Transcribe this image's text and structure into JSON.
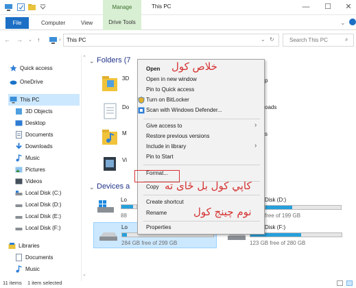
{
  "window": {
    "ribbon_context_label": "Manage",
    "title": "This PC",
    "minimize_label": "—",
    "maximize_label": "☐",
    "close_label": "✕",
    "accent_color": "#1c6fc4"
  },
  "ribbon": {
    "tabs": [
      "File",
      "Computer",
      "View",
      "Drive Tools"
    ]
  },
  "address": {
    "path_text": "This PC",
    "search_placeholder": "Search This PC"
  },
  "nav_pane": {
    "items": [
      {
        "label": "Quick access",
        "icon": "star-icon"
      },
      {
        "label": "OneDrive",
        "icon": "cloud-icon"
      },
      {
        "label": "This PC",
        "icon": "computer-icon",
        "selected": true
      },
      {
        "label": "3D Objects",
        "icon": "cube-icon"
      },
      {
        "label": "Desktop",
        "icon": "desktop-icon"
      },
      {
        "label": "Documents",
        "icon": "document-icon"
      },
      {
        "label": "Downloads",
        "icon": "download-icon"
      },
      {
        "label": "Music",
        "icon": "music-icon"
      },
      {
        "label": "Pictures",
        "icon": "pictures-icon"
      },
      {
        "label": "Videos",
        "icon": "videos-icon"
      },
      {
        "label": "Local Disk (C:)",
        "icon": "drive-icon"
      },
      {
        "label": "Local Disk (D:)",
        "icon": "drive-icon"
      },
      {
        "label": "Local Disk (E:)",
        "icon": "drive-icon"
      },
      {
        "label": "Local Disk (F:)",
        "icon": "drive-icon"
      },
      {
        "label": "Libraries",
        "icon": "libraries-icon"
      },
      {
        "label": "Documents",
        "icon": "document-icon"
      },
      {
        "label": "Music",
        "icon": "music-icon"
      }
    ]
  },
  "content": {
    "folders_group": "Folders (7",
    "devices_group": "Devices a",
    "folder_partials": [
      "3D",
      "Do",
      "M",
      "Vi"
    ],
    "folder_right_partials": [
      "p",
      "oads",
      "s"
    ],
    "drives": [
      {
        "name_partial": "Lo",
        "free_partial": "88",
        "fill_fraction": 0.78
      },
      {
        "name_partial": "Lo",
        "free_text": "284 GB free of 299 GB",
        "fill_fraction": 0.05,
        "selected": true
      },
      {
        "name_partial": "Disk (D:)",
        "free_text": "free of 199 GB",
        "fill_fraction": 0.35
      },
      {
        "name_partial": "Disk (F:)",
        "free_text": "123 GB free of 280 GB",
        "fill_fraction": 0.56
      }
    ],
    "partial_lo_3": "Lo"
  },
  "context_menu": {
    "items": {
      "open": "Open",
      "open_new_window": "Open in new window",
      "pin_quick_access": "Pin to Quick access",
      "bitlocker": "Turn on BitLocker",
      "defender": "Scan with Windows Defender...",
      "give_access": "Give access to",
      "restore": "Restore previous versions",
      "include_library": "Include in library",
      "pin_start": "Pin to Start",
      "format": "Format...",
      "copy": "Copy",
      "create_shortcut": "Create shortcut",
      "rename": "Rename",
      "properties": "Properties"
    },
    "annotations": {
      "open_note": "خلاص کول",
      "copy_note": "کاپي کول بل ځای ته",
      "rename_note": "نوم چینج کول"
    },
    "annotation_color": "#d53030"
  },
  "status": {
    "item_count": "11 items",
    "selection": "1 item selected"
  }
}
